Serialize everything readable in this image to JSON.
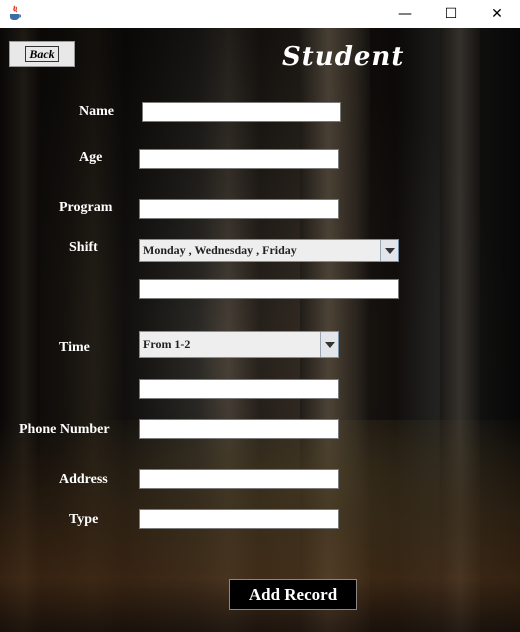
{
  "window": {
    "minimize_glyph": "—",
    "maximize_glyph": "☐",
    "close_glyph": "✕"
  },
  "header": {
    "back_label": "Back",
    "title": "Student"
  },
  "form": {
    "name_label": "Name",
    "age_label": "Age",
    "program_label": "Program",
    "shift_label": "Shift",
    "shift_selected": "Monday , Wednesday , Friday",
    "time_label": "Time",
    "time_selected": "From 1-2",
    "phone_label": "Phone Number",
    "address_label": "Address",
    "type_label": "Type",
    "name_value": "",
    "age_value": "",
    "program_value": "",
    "shift_extra_value": "",
    "time_extra_value": "",
    "phone_value": "",
    "address_value": "",
    "type_value": ""
  },
  "actions": {
    "add_record_label": "Add Record"
  },
  "colors": {
    "label_text": "#ffffff",
    "button_bg": "#000000",
    "combo_bg": "#eeeeee"
  }
}
